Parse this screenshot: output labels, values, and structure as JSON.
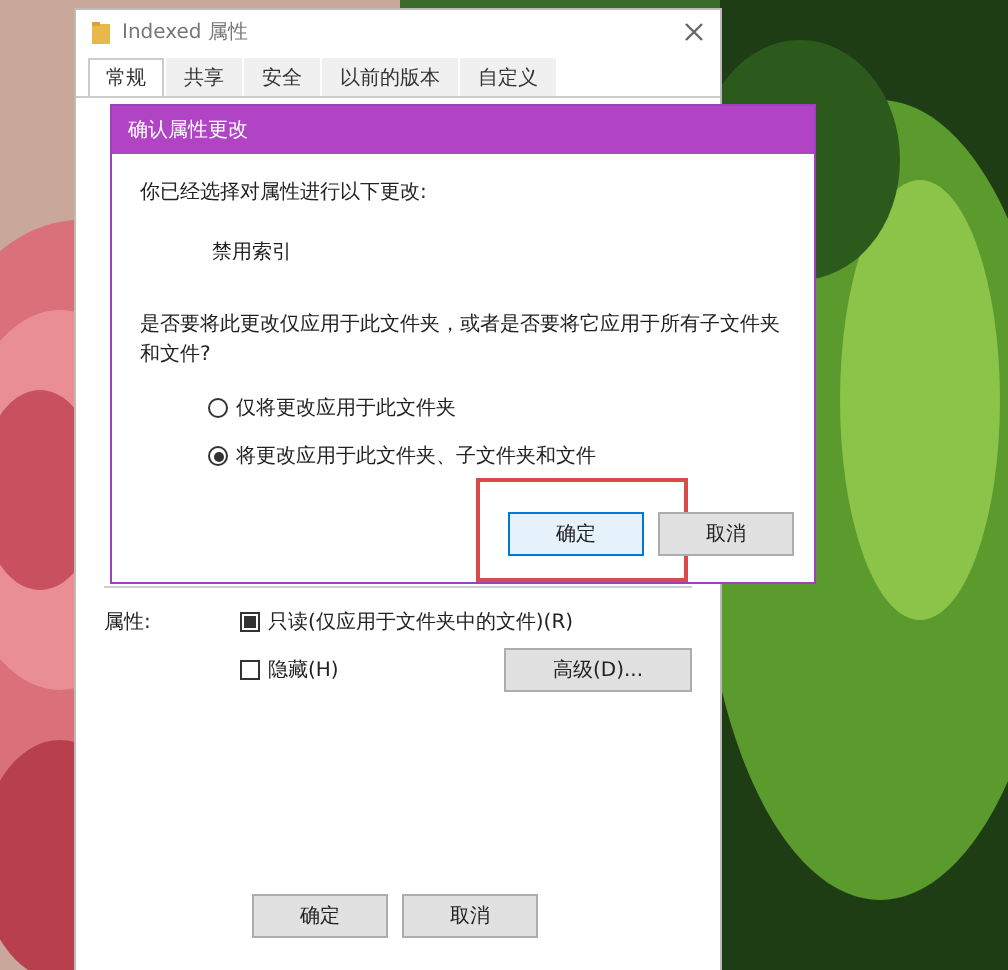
{
  "properties_window": {
    "title": "Indexed 属性",
    "tabs": [
      {
        "label": "常规",
        "selected": true
      },
      {
        "label": "共享",
        "selected": false
      },
      {
        "label": "安全",
        "selected": false
      },
      {
        "label": "以前的版本",
        "selected": false
      },
      {
        "label": "自定义",
        "selected": false
      }
    ],
    "attributes_label": "属性:",
    "attributes": [
      {
        "label": "只读(仅应用于文件夹中的文件)(R)",
        "checked": false,
        "indeterminate": true
      },
      {
        "label": "隐藏(H)",
        "checked": false,
        "indeterminate": false
      }
    ],
    "advanced_button": "高级(D)...",
    "buttons": [
      "确定",
      "取消"
    ]
  },
  "confirm_dialog": {
    "title": "确认属性更改",
    "intro": "你已经选择对属性进行以下更改:",
    "change": "禁用索引",
    "question": "是否要将此更改仅应用于此文件夹，或者是否要将它应用于所有子文件夹和文件?",
    "options": [
      {
        "label": "仅将更改应用于此文件夹",
        "selected": false
      },
      {
        "label": "将更改应用于此文件夹、子文件夹和文件",
        "selected": true
      }
    ],
    "buttons": [
      {
        "label": "确定",
        "highlighted": true
      },
      {
        "label": "取消",
        "highlighted": false
      }
    ]
  }
}
